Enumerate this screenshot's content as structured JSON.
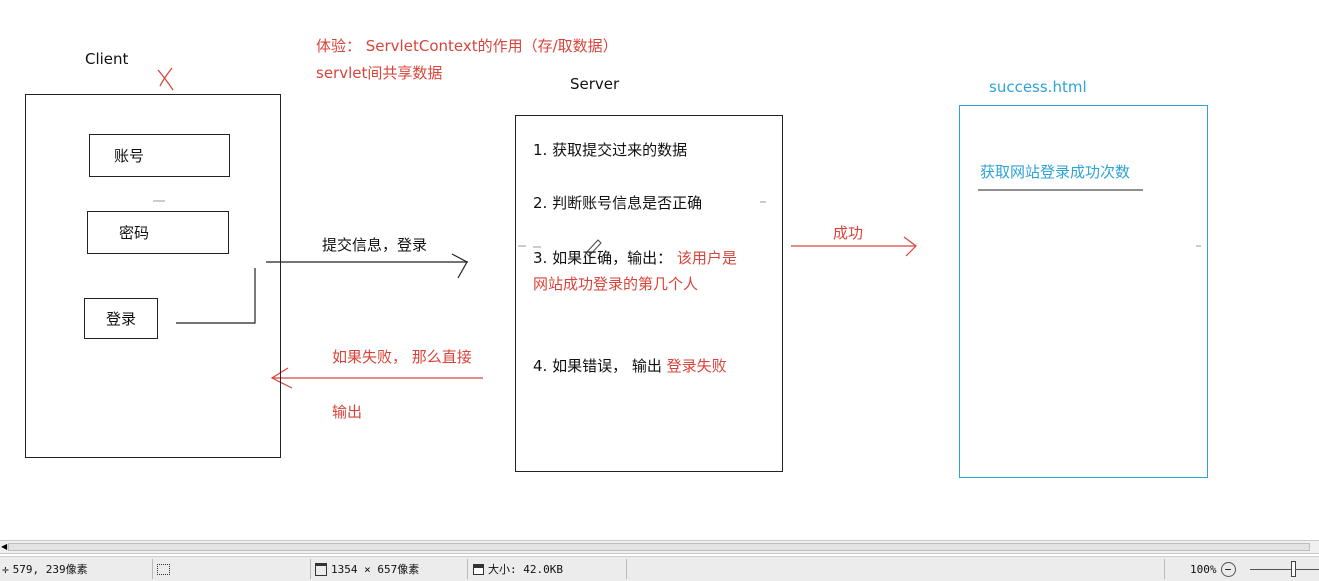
{
  "annotation": {
    "line1": "体验： ServletContext的作用（存/取数据）",
    "line2": "servlet间共享数据"
  },
  "client": {
    "title": "Client",
    "cross_mark": "X",
    "account_label": "账号",
    "password_label": "密码",
    "login_label": "登录"
  },
  "server": {
    "title": "Server",
    "step1": "1. 获取提交过来的数据",
    "step2": "2. 判断账号信息是否正确",
    "step3_prefix": "3. 如果正确，输出：",
    "step3_highlight": "该用户是网站成功登录的第几个人",
    "step4_prefix": "4. 如果错误， 输出",
    "step4_highlight": "登录失败"
  },
  "success": {
    "title": "success.html",
    "content": "获取网站登录成功次数"
  },
  "arrows": {
    "submit_label": "提交信息，登录",
    "success_label": "成功",
    "fail_label_line1": "如果失败， 那么直接",
    "fail_label_line2": "输出"
  },
  "colors": {
    "annotation_red": "#d9443a",
    "success_blue": "#2ea3d6",
    "box_border": "#222222"
  },
  "statusbar": {
    "cursor_icon": "crosshair-icon",
    "cursor_position": "579, 239像素",
    "selection_icon": "selection-icon",
    "image_size_icon": "image-size-icon",
    "image_size": "1354 × 657像素",
    "file_size_icon": "disk-icon",
    "file_size": "大小: 42.0KB",
    "zoom": "100%",
    "zoom_out_symbol": "−"
  }
}
